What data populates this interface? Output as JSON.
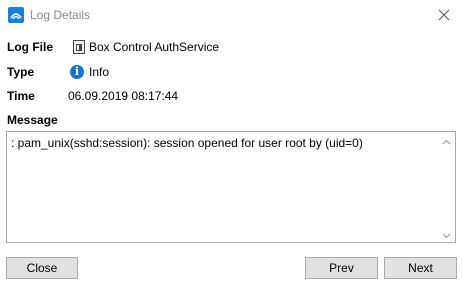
{
  "window": {
    "title": "Log Details"
  },
  "details": {
    "log_file_label": "Log File",
    "log_file_value": "Box Control AuthService",
    "type_label": "Type",
    "type_value": "Info",
    "time_label": "Time",
    "time_value": "06.09.2019 08:17:44",
    "message_label": "Message",
    "message_text": ": pam_unix(sshd:session): session opened for user root by (uid=0)"
  },
  "buttons": {
    "close": "Close",
    "prev": "Prev",
    "next": "Next"
  },
  "colors": {
    "accent": "#1a73d4",
    "button_bg": "#e1e1e1",
    "button_border": "#adadad"
  }
}
